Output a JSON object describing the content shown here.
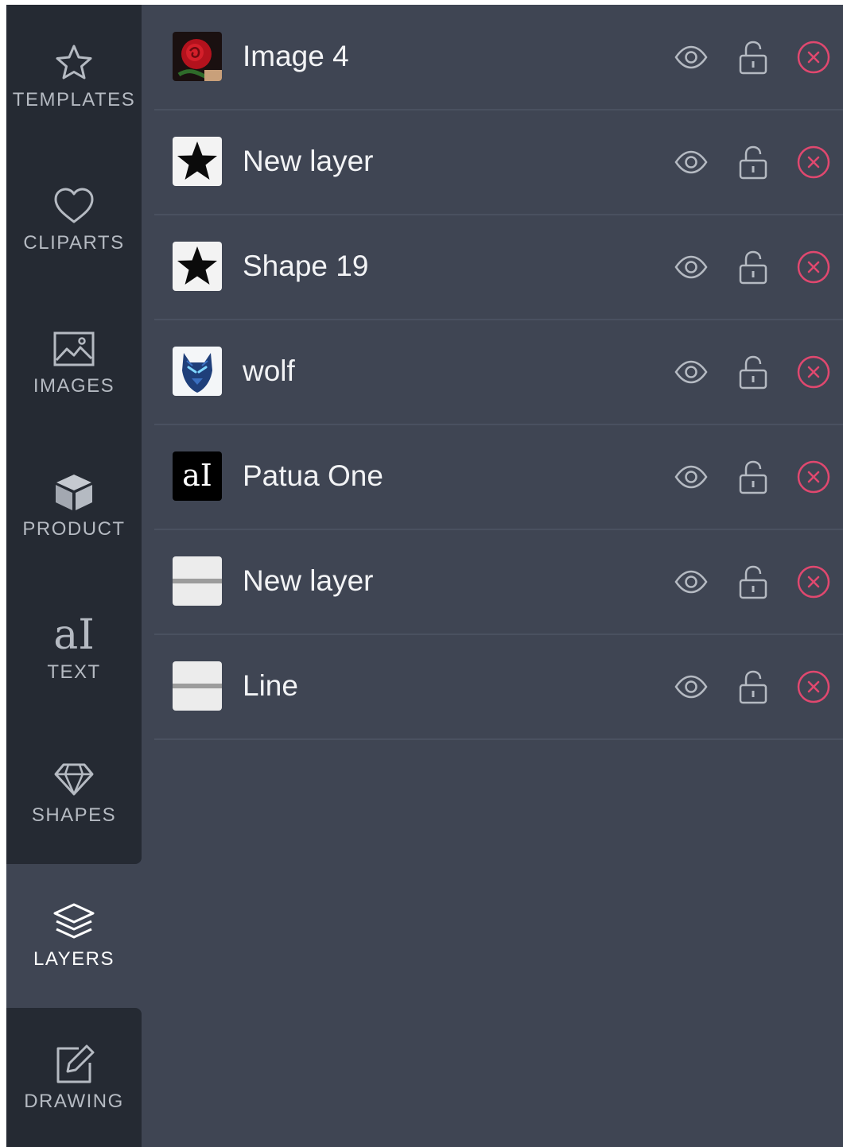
{
  "sidebar": {
    "items": [
      {
        "label": "TEMPLATES",
        "icon": "star-icon"
      },
      {
        "label": "CLIPARTS",
        "icon": "heart-icon"
      },
      {
        "label": "IMAGES",
        "icon": "image-icon"
      },
      {
        "label": "PRODUCT",
        "icon": "cube-icon"
      },
      {
        "label": "TEXT",
        "icon": "text-icon",
        "glyph": "aI"
      },
      {
        "label": "SHAPES",
        "icon": "diamond-icon"
      },
      {
        "label": "LAYERS",
        "icon": "layers-icon",
        "active": true
      },
      {
        "label": "DRAWING",
        "icon": "edit-icon"
      }
    ]
  },
  "layers": [
    {
      "name": "Image 4",
      "thumb": "rose-thumbnail"
    },
    {
      "name": "New layer",
      "thumb": "star-thumbnail"
    },
    {
      "name": "Shape 19",
      "thumb": "star-thumbnail"
    },
    {
      "name": "wolf",
      "thumb": "wolf-thumbnail"
    },
    {
      "name": "Patua One",
      "thumb": "text-thumbnail",
      "glyph": "aI"
    },
    {
      "name": "New layer",
      "thumb": "line-thumbnail"
    },
    {
      "name": "Line",
      "thumb": "line-thumbnail"
    }
  ],
  "colors": {
    "panel_bg": "#3f4553",
    "sidebar_bg": "#252a33",
    "delete_accent": "#e0486f",
    "icon_gray": "#b5bac2"
  }
}
